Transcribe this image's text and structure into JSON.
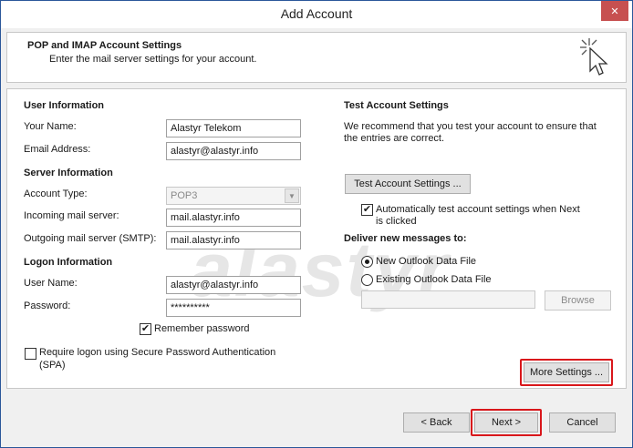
{
  "window": {
    "title": "Add Account",
    "close_glyph": "✕"
  },
  "header": {
    "title": "POP and IMAP Account Settings",
    "subtitle": "Enter the mail server settings for your account.",
    "icon": "cursor-click-icon"
  },
  "user_info": {
    "section_title": "User Information",
    "your_name_label": "Your Name:",
    "your_name_value": "Alastyr Telekom",
    "email_label": "Email Address:",
    "email_value": "alastyr@alastyr.info"
  },
  "server_info": {
    "section_title": "Server Information",
    "account_type_label": "Account Type:",
    "account_type_value": "POP3",
    "incoming_label": "Incoming mail server:",
    "incoming_value": "mail.alastyr.info",
    "outgoing_label": "Outgoing mail server (SMTP):",
    "outgoing_value": "mail.alastyr.info"
  },
  "logon_info": {
    "section_title": "Logon Information",
    "username_label": "User Name:",
    "username_value": "alastyr@alastyr.info",
    "password_label": "Password:",
    "password_value": "**********",
    "remember_label": "Remember password",
    "remember_checked": "✔",
    "spa_label_line1": "Require logon using Secure Password Authentication",
    "spa_label_line2": "(SPA)"
  },
  "test_settings": {
    "section_title": "Test Account Settings",
    "desc_line1": "We recommend that you test your account to ensure that",
    "desc_line2": "the entries are correct.",
    "test_button": "Test Account Settings ...",
    "auto_test_line1": "Automatically test account settings when Next",
    "auto_test_line2": "is clicked",
    "auto_test_checked": "✔"
  },
  "deliver": {
    "section_title": "Deliver new messages to:",
    "option_new": "New Outlook Data File",
    "option_existing": "Existing Outlook Data File",
    "existing_path": "",
    "browse_button": "Browse"
  },
  "more_settings_button": "More Settings ...",
  "footer": {
    "back_button": "< Back",
    "next_button": "Next >",
    "cancel_button": "Cancel"
  },
  "watermark": "alastyr",
  "colors": {
    "highlight": "#d9171b",
    "close": "#c75050"
  }
}
